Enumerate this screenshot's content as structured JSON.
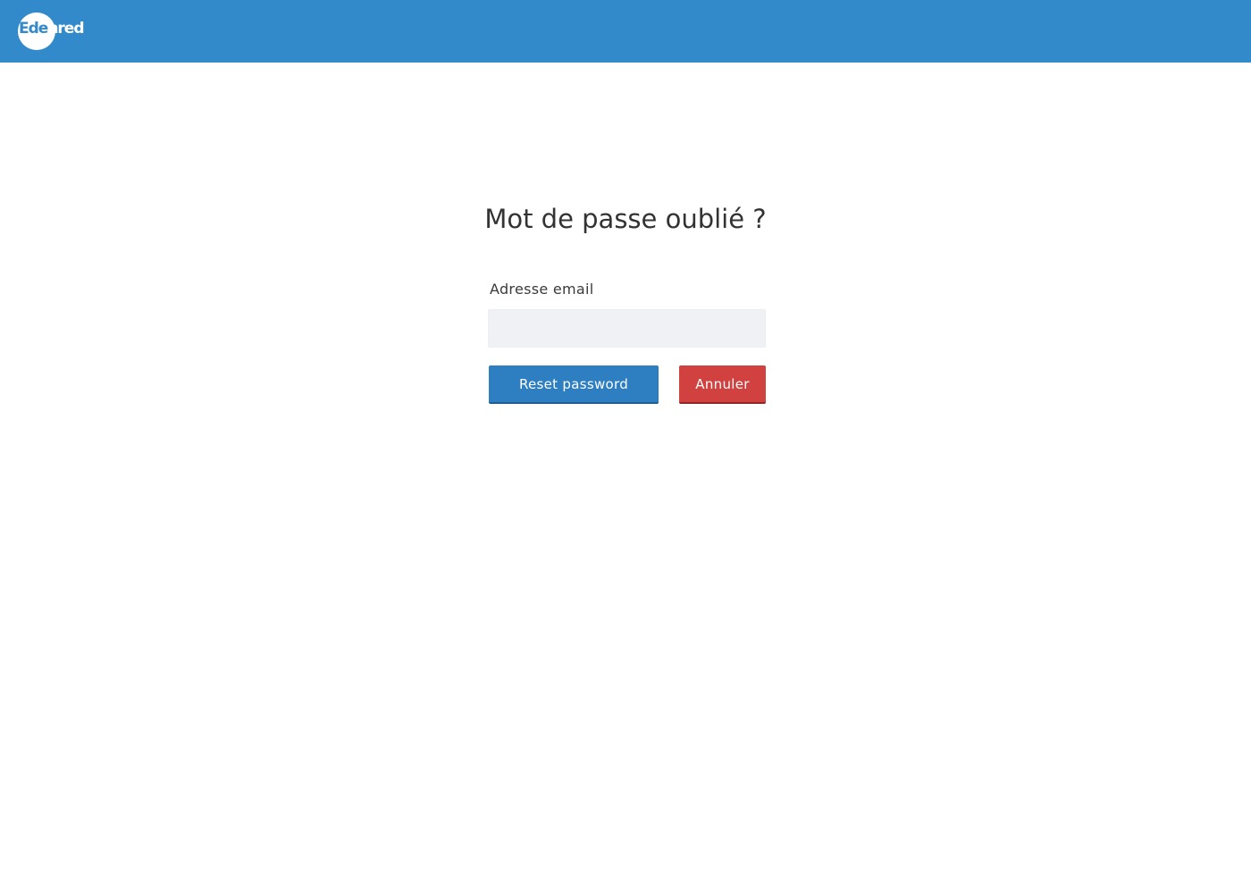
{
  "header": {
    "logo_text_a": "Ede",
    "logo_text_b": "nred",
    "brand_color": "#338acb"
  },
  "form": {
    "title": "Mot de passe oublié ?",
    "email_label": "Adresse email",
    "email_value": "",
    "email_placeholder": "",
    "reset_button_label": "Reset password",
    "cancel_button_label": "Annuler",
    "reset_color": "#2e7fc1",
    "cancel_color": "#d0413f"
  }
}
